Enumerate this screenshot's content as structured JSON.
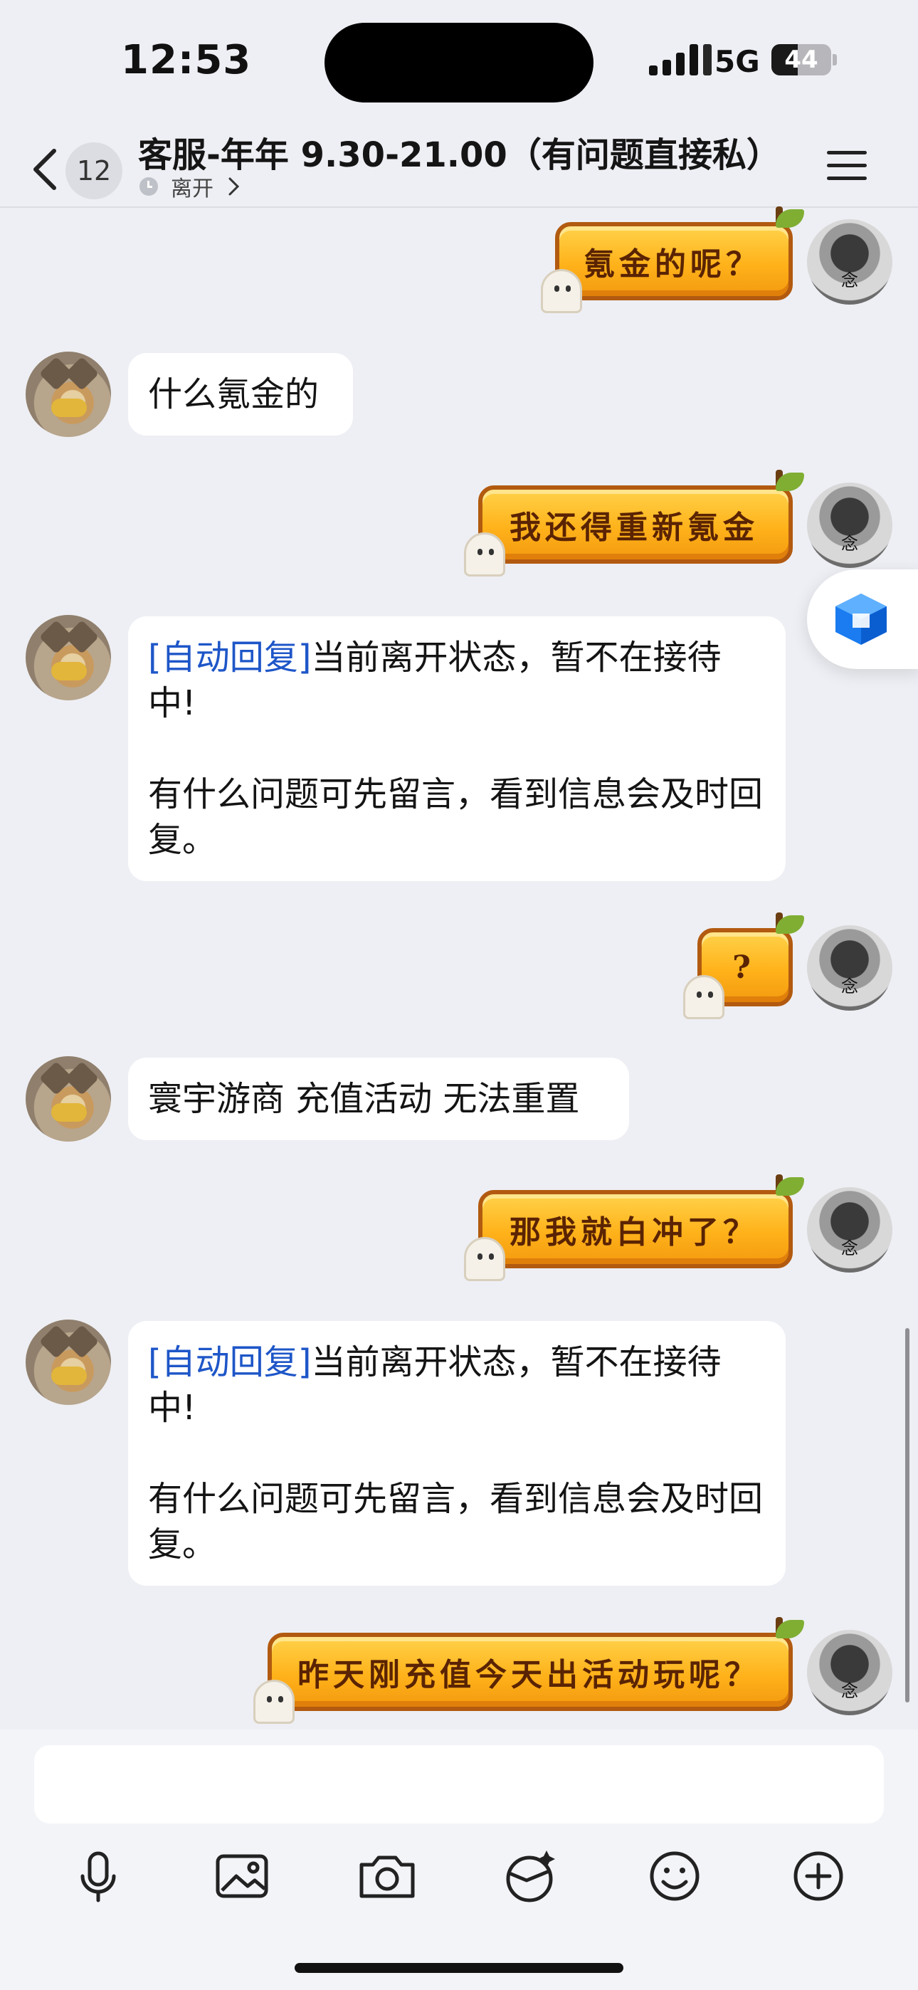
{
  "status_bar": {
    "time": "12:53",
    "network": "5G",
    "battery": "44"
  },
  "header": {
    "back_badge": "12",
    "title": "客服-年年 9.30-21.00（有问题直接私）",
    "presence": "离开"
  },
  "messages": [
    {
      "side": "right",
      "kind": "sticker",
      "text": "氪金的呢？"
    },
    {
      "side": "left",
      "kind": "text",
      "text": "什么氪金的"
    },
    {
      "side": "right",
      "kind": "sticker",
      "text": "我还得重新氪金"
    },
    {
      "side": "left",
      "kind": "text",
      "prefix": "[自动回复]",
      "line1": "当前离开状态，暂不在接待中!",
      "line2": "有什么问题可先留言，看到信息会及时回复。"
    },
    {
      "side": "right",
      "kind": "sticker",
      "text": "?"
    },
    {
      "side": "left",
      "kind": "text",
      "text": "寰宇游商 充值活动 无法重置"
    },
    {
      "side": "right",
      "kind": "sticker",
      "text": "那我就白冲了？"
    },
    {
      "side": "left",
      "kind": "text",
      "prefix": "[自动回复]",
      "line1": "当前离开状态，暂不在接待中!",
      "line2": "有什么问题可先留言，看到信息会及时回复。"
    },
    {
      "side": "right",
      "kind": "sticker",
      "text": "昨天刚充值今天出活动玩呢？"
    }
  ],
  "toolbar": {
    "icons": [
      "microphone-icon",
      "image-icon",
      "camera-icon",
      "sticker-icon",
      "emoji-icon",
      "plus-icon"
    ]
  },
  "colors": {
    "auto_reply": "#1e56c8",
    "sticker": "#ffb21a",
    "background": "#eeeff4"
  }
}
